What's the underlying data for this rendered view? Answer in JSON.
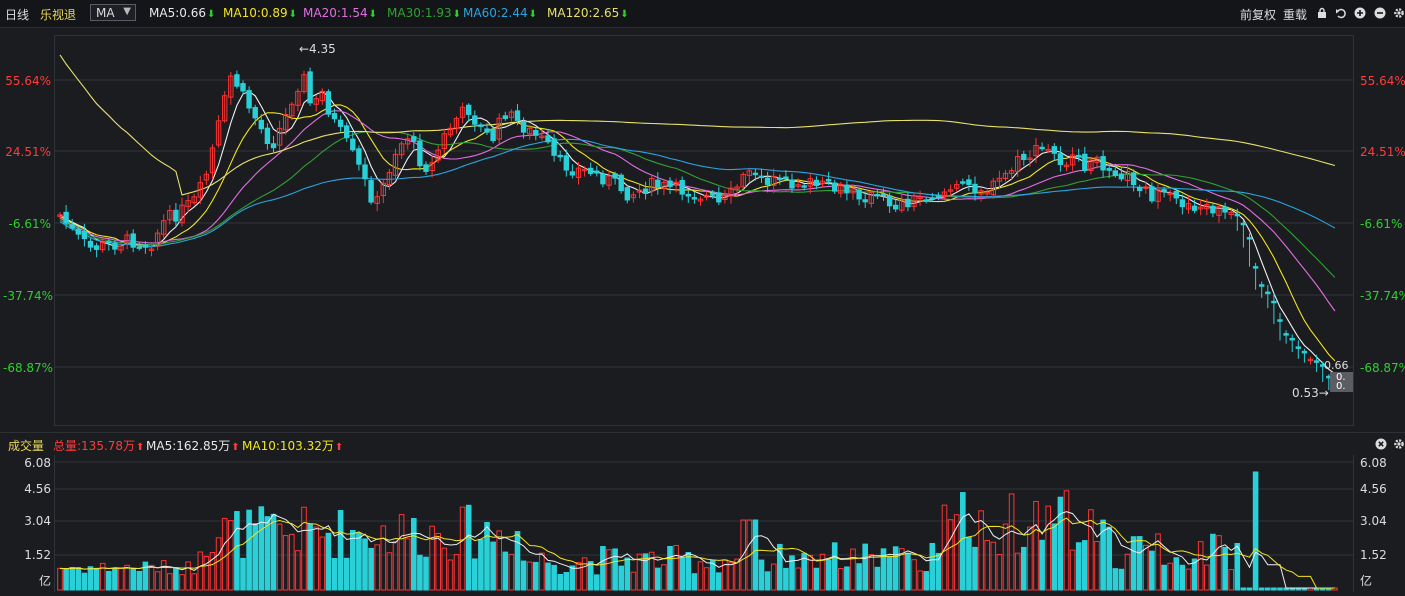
{
  "topbar": {
    "period": "日线",
    "stock_name": "乐视退",
    "indicator": "MA",
    "ma_items": [
      {
        "label": "MA5:0.66",
        "color": "#e8e8e8"
      },
      {
        "label": "MA10:0.89",
        "color": "#f2e51f"
      },
      {
        "label": "MA20:1.54",
        "color": "#e36ee3"
      },
      {
        "label": "MA30:1.93",
        "color": "#32a032"
      },
      {
        "label": "MA60:2.44",
        "color": "#2aa4e0"
      },
      {
        "label": "MA120:2.65",
        "color": "#e8e06a"
      }
    ],
    "down_arrow": "⬇",
    "adjust": "前复权",
    "reload": "重载"
  },
  "price_axis": {
    "labels": [
      "55.64%",
      "24.51%",
      "-6.61%",
      "-37.74%",
      "-68.87%"
    ],
    "colors": [
      "#ff3b3b",
      "#ff3b3b",
      "#2fcf2f",
      "#2fcf2f",
      "#2fcf2f"
    ]
  },
  "annotations": {
    "high": "←4.35",
    "low": "0.53→",
    "last_ma5": "0.66",
    "last_ma10": "0.",
    "last_price": "0."
  },
  "volume": {
    "title": "成交量",
    "total": "总量:135.78万",
    "ma5": "MA5:162.85万",
    "ma10": "MA10:103.32万",
    "up_arrow": "⬆",
    "axis_labels": [
      "6.08",
      "4.56",
      "3.04",
      "1.52"
    ],
    "unit": "亿"
  },
  "colors": {
    "up": "#ff3232",
    "down": "#2ad0d8",
    "background": "#1b1c20"
  }
}
